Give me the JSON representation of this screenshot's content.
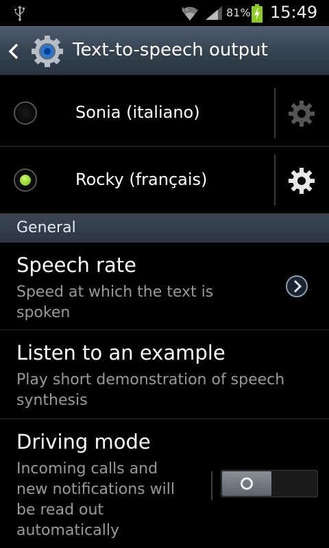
{
  "status_bar": {
    "battery_percent": "81%",
    "time": "15:49",
    "icons": [
      "usb-icon",
      "wifi-icon",
      "signal-icon",
      "battery-charging-icon"
    ]
  },
  "action_bar": {
    "title": "Text-to-speech output",
    "icons": [
      "back-chevron-icon",
      "settings-gear-app-icon"
    ]
  },
  "engines": [
    {
      "label": "Sonia (italiano)",
      "selected": false,
      "settings_enabled": false
    },
    {
      "label": "Rocky (français)",
      "selected": true,
      "settings_enabled": true
    }
  ],
  "section": {
    "label": "General"
  },
  "prefs": {
    "speech_rate": {
      "title": "Speech rate",
      "summary_line1": "Speed at which the text is",
      "summary_line2": "spoken"
    },
    "listen_example": {
      "title": "Listen to an example",
      "summary_line1": "Play short demonstration of speech",
      "summary_line2": "synthesis"
    },
    "driving_mode": {
      "title": "Driving mode",
      "summary_line1": "Incoming calls and",
      "summary_line2": "new notifications will",
      "summary_line3": "be read out",
      "summary_line4": "automatically",
      "toggle_on": false
    }
  },
  "colors": {
    "accent_green": "#8ccc22",
    "action_bar": "#34414f",
    "summary_text": "#9a9a9a"
  }
}
